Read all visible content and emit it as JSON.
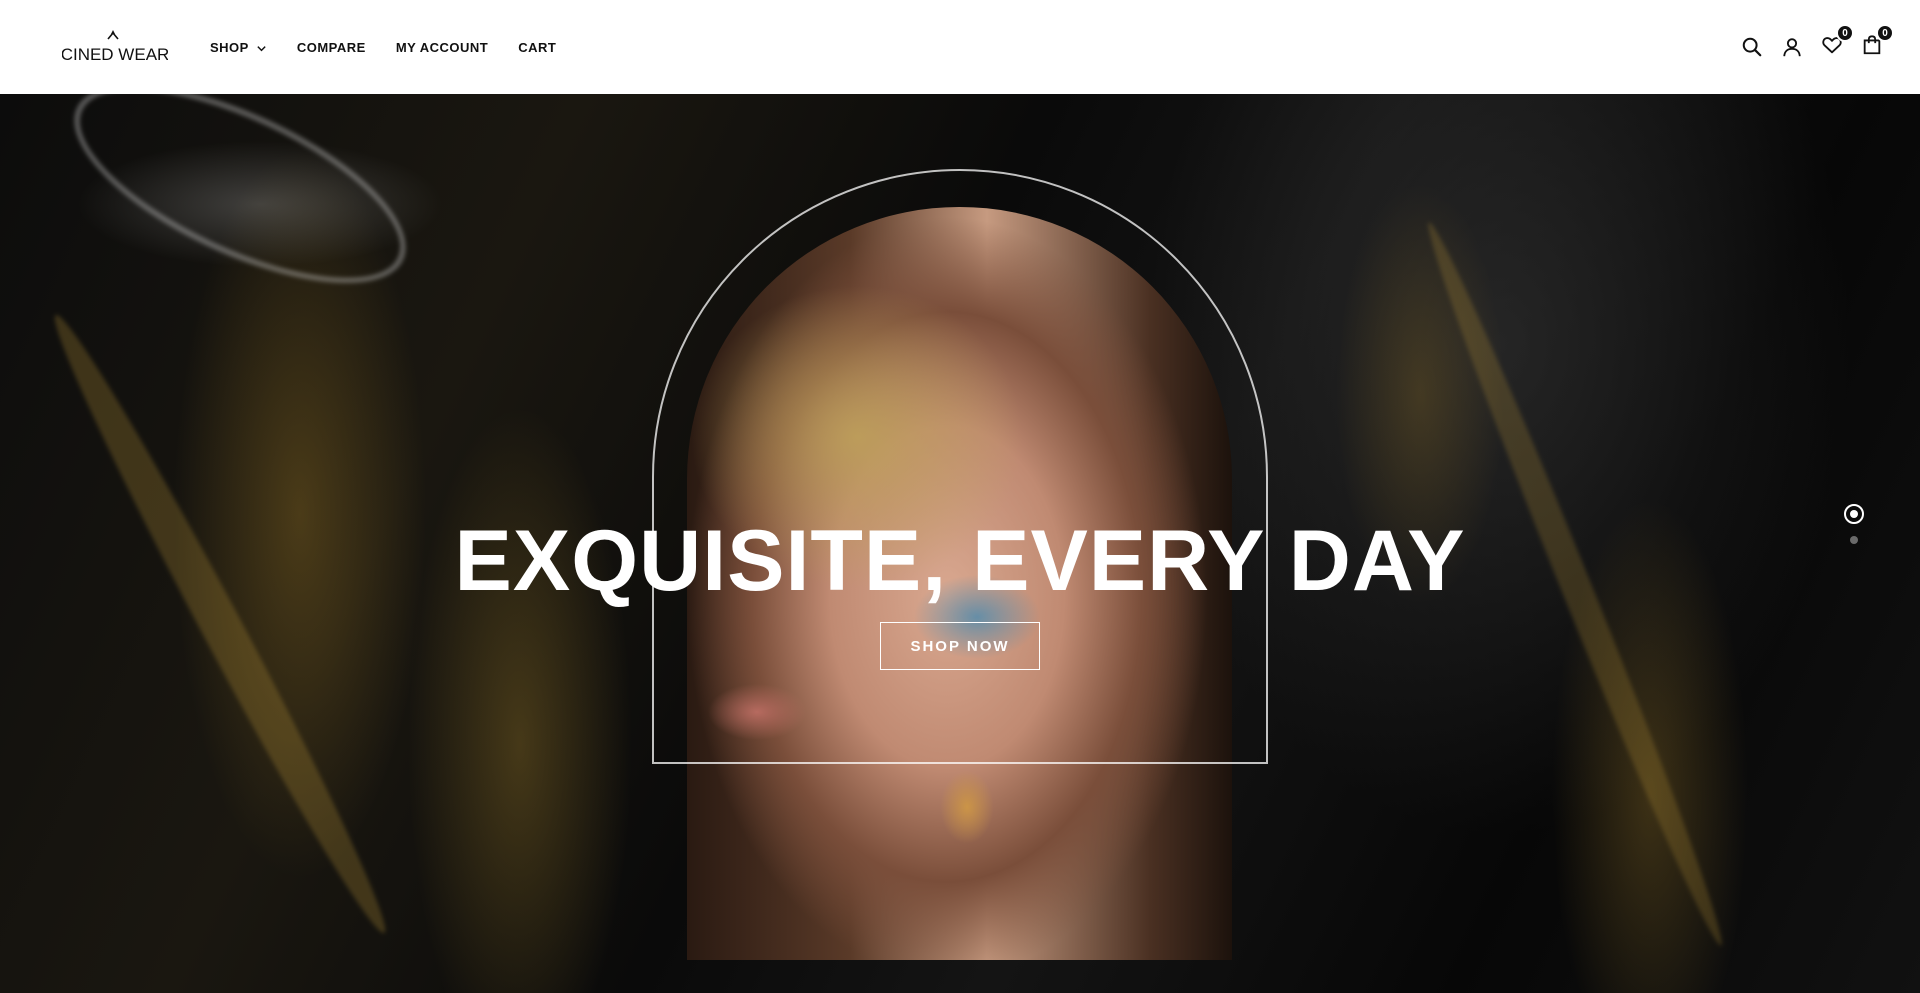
{
  "brand": {
    "logo_text": "CINED WEAR"
  },
  "nav": {
    "items": [
      {
        "label": "SHOP",
        "has_dropdown": true
      },
      {
        "label": "COMPARE"
      },
      {
        "label": "MY ACCOUNT"
      },
      {
        "label": "CART"
      }
    ]
  },
  "header_icons": {
    "search": "search-icon",
    "account": "user-icon",
    "wishlist": {
      "icon": "heart-icon",
      "count": "0"
    },
    "cart": {
      "icon": "bag-icon",
      "count": "0"
    }
  },
  "hero": {
    "headline": "EXQUISITE, EVERY DAY",
    "cta_label": "SHOP NOW",
    "slides_total": 2,
    "active_slide": 1
  },
  "colors": {
    "header_bg": "#ffffff",
    "text": "#111111",
    "hero_text": "#ffffff",
    "accent_gold": "#c9a24a"
  }
}
